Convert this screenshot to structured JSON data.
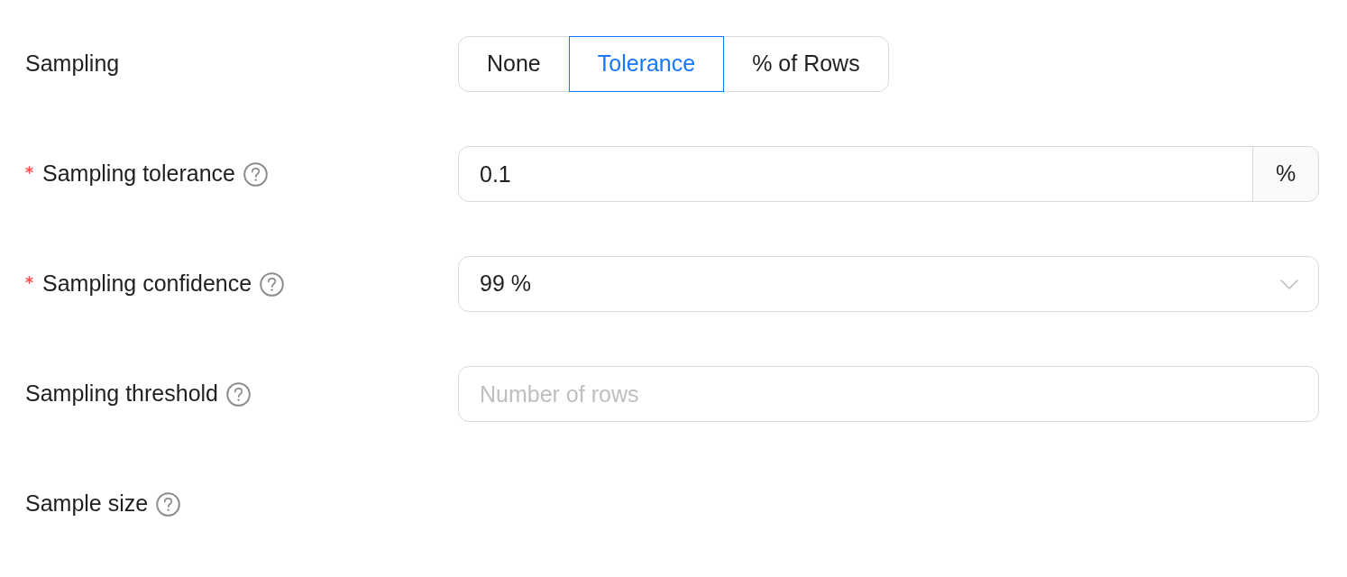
{
  "fields": [
    {
      "kind": "segmented",
      "label": "Sampling",
      "required": false,
      "help": false,
      "options": [
        {
          "label": "None",
          "selected": false
        },
        {
          "label": "Tolerance",
          "selected": true
        },
        {
          "label": "% of Rows",
          "selected": false
        }
      ]
    },
    {
      "kind": "input_addon",
      "label": "Sampling tolerance",
      "required": true,
      "help": true,
      "value": "0.1",
      "addon": "%"
    },
    {
      "kind": "select",
      "label": "Sampling confidence",
      "required": true,
      "help": true,
      "value": "99 %"
    },
    {
      "kind": "input",
      "label": "Sampling threshold",
      "required": false,
      "help": true,
      "placeholder": "Number of rows"
    },
    {
      "kind": "empty",
      "label": "Sample size",
      "required": false,
      "help": true
    }
  ]
}
